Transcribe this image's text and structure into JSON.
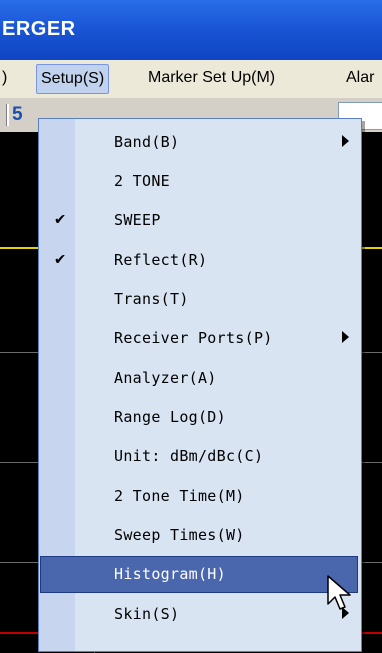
{
  "window": {
    "title": "ERGER"
  },
  "menubar": {
    "items": [
      {
        "label": ")"
      },
      {
        "label": "Setup(S)"
      },
      {
        "label": "Marker Set Up(M)"
      },
      {
        "label": "Alar"
      }
    ]
  },
  "toolbar": {
    "number": "5"
  },
  "setup_menu": {
    "items": [
      {
        "label": "Band(B)",
        "checked": false,
        "submenu": true
      },
      {
        "label": "2 TONE",
        "checked": false,
        "submenu": false
      },
      {
        "label": "SWEEP",
        "checked": true,
        "submenu": false
      },
      {
        "label": "Reflect(R)",
        "checked": true,
        "submenu": false
      },
      {
        "label": "Trans(T)",
        "checked": false,
        "submenu": false
      },
      {
        "label": "Receiver Ports(P)",
        "checked": false,
        "submenu": true
      },
      {
        "label": "Analyzer(A)",
        "checked": false,
        "submenu": false
      },
      {
        "label": "Range Log(D)",
        "checked": false,
        "submenu": false
      },
      {
        "label": "Unit: dBm/dBc(C)",
        "checked": false,
        "submenu": false
      },
      {
        "label": "2 Tone Time(M)",
        "checked": false,
        "submenu": false
      },
      {
        "label": "Sweep Times(W)",
        "checked": false,
        "submenu": false
      },
      {
        "label": "Histogram(H)",
        "checked": false,
        "submenu": false,
        "highlighted": true
      },
      {
        "label": "Skin(S)",
        "checked": false,
        "submenu": true
      }
    ],
    "check_glyph": "✔"
  },
  "colors": {
    "title_bar": "#1a56d6",
    "menu_bg": "#d9e4f3",
    "highlight": "#4a67ad",
    "trace_yellow": "#e6d200",
    "trace_red": "#c00000"
  }
}
